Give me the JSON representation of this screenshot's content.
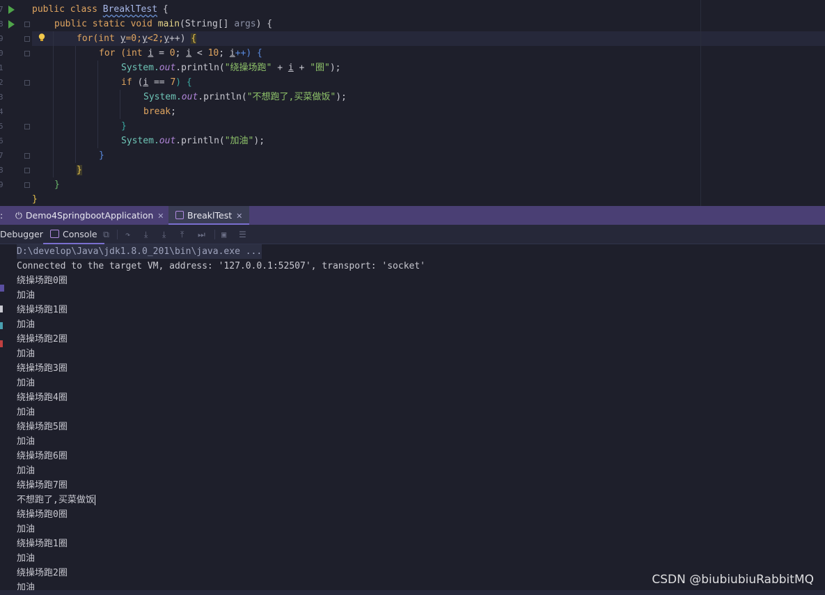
{
  "editor": {
    "line_numbers": [
      "7",
      "8",
      "9",
      "0",
      "1",
      "2",
      "3",
      "4",
      "5",
      "6",
      "7",
      "8",
      "9"
    ],
    "code": {
      "l1": {
        "k1": "public class ",
        "cls": "BreaklTest",
        " b": " {"
      },
      "l2": {
        "k1": "public static void ",
        "fn": "main",
        "p1": "(String[] ",
        "param": "args",
        ") {": ") {"
      },
      "l3": {
        "k1": "for",
        "p1": "(int ",
        "y": "y",
        "p2": "=0;",
        "y2": "y",
        "p3": "<2;",
        "y3": "y",
        "p4": "++) ",
        "b": "{"
      },
      "l4": {
        "k1": "for",
        "p1": " (int ",
        "i": "i",
        "p2": " = ",
        "n0": "0",
        "p3": "; ",
        "i2": "i",
        "p4": " < ",
        "n10": "10",
        "p5": "; ",
        "i3": "i",
        "p6": "++) {"
      },
      "l5": {
        "sys": "System.",
        "out": "out",
        "p1": ".println(",
        "s": "\"绕操场跑\"",
        "p2": " + ",
        "i": "i",
        "p3": " + ",
        "s2": "\"圈\"",
        "p4": ");"
      },
      "l6": {
        "k1": "if",
        "p1": " (",
        "i": "i",
        "p2": " == ",
        "n": "7",
        "p3": ") {"
      },
      "l7": {
        "sys": "System.",
        "out": "out",
        "p1": ".println(",
        "s": "\"不想跑了,买菜做饭\"",
        "p2": ");"
      },
      "l8": {
        "k1": "break",
        "p": ";"
      },
      "l9": {
        "b": "}"
      },
      "l10": {
        "sys": "System.",
        "out": "out",
        "p1": ".println(",
        "s": "\"加油\"",
        "p2": ");"
      },
      "l11": {
        "b": "}"
      },
      "l12": {
        "b": "}"
      },
      "l13": {
        "b": "}"
      },
      "l14": {
        "b": "}"
      }
    }
  },
  "tabs": {
    "partial_left": ":",
    "tab1": {
      "label": "Demo4SpringbootApplication",
      "close": "✕"
    },
    "tab2": {
      "label": "BreaklTest",
      "close": "✕"
    }
  },
  "toolbar": {
    "debugger_label": "Debugger",
    "console_label": "Console"
  },
  "console": {
    "lines": [
      "D:\\develop\\Java\\jdk1.8.0_201\\bin\\java.exe ...",
      "Connected to the target VM, address: '127.0.0.1:52507', transport: 'socket'",
      "绕操场跑0圈",
      "加油",
      "绕操场跑1圈",
      "加油",
      "绕操场跑2圈",
      "加油",
      "绕操场跑3圈",
      "加油",
      "绕操场跑4圈",
      "加油",
      "绕操场跑5圈",
      "加油",
      "绕操场跑6圈",
      "加油",
      "绕操场跑7圈",
      "不想跑了,买菜做饭",
      "绕操场跑0圈",
      "加油",
      "绕操场跑1圈",
      "加油",
      "绕操场跑2圈",
      "加油"
    ]
  },
  "watermark": "CSDN @biubiubiuRabbitMQ",
  "colors": {
    "background": "#1e1f2b",
    "tab_bar": "#4a3f74",
    "keyword": "#e0a560",
    "string": "#8fc36a",
    "run_icon": "#4fa44a"
  }
}
